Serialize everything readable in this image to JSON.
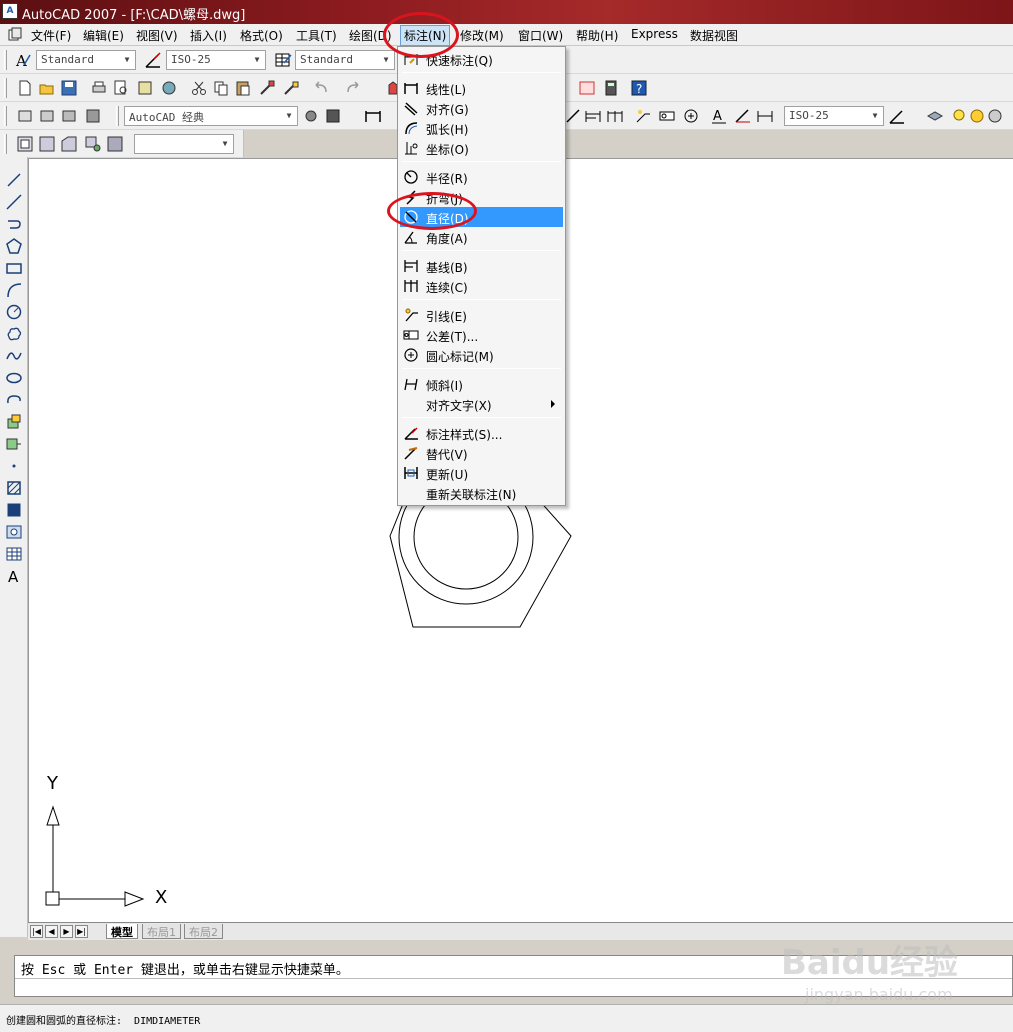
{
  "window": {
    "title": "AutoCAD 2007 - [F:\\CAD\\螺母.dwg]"
  },
  "menubar": {
    "items": [
      "文件(F)",
      "编辑(E)",
      "视图(V)",
      "插入(I)",
      "格式(O)",
      "工具(T)",
      "绘图(D)",
      "标注(N)",
      "修改(M)",
      "窗口(W)",
      "帮助(H)",
      "Express",
      "数据视图"
    ],
    "active": "标注(N)"
  },
  "toolbar_styles": {
    "text_style": "Standard",
    "dim_style": "ISO-25",
    "table_style": "Standard"
  },
  "toolbar_workspace": {
    "workspace": "AutoCAD 经典",
    "dim_style_right": "ISO-25"
  },
  "dropdown": {
    "items": [
      {
        "label": "快速标注(Q)",
        "icon": "quick-dimension-icon"
      },
      {
        "label": "线性(L)",
        "icon": "linear-dimension-icon"
      },
      {
        "label": "对齐(G)",
        "icon": "aligned-dimension-icon"
      },
      {
        "label": "弧长(H)",
        "icon": "arc-length-icon"
      },
      {
        "label": "坐标(O)",
        "icon": "ordinate-icon"
      },
      {
        "label": "半径(R)",
        "icon": "radius-icon"
      },
      {
        "label": "折弯(J)",
        "icon": "jogged-icon"
      },
      {
        "label": "直径(D)",
        "icon": "diameter-icon"
      },
      {
        "label": "角度(A)",
        "icon": "angular-icon"
      },
      {
        "label": "基线(B)",
        "icon": "baseline-icon"
      },
      {
        "label": "连续(C)",
        "icon": "continue-icon"
      },
      {
        "label": "引线(E)",
        "icon": "leader-icon"
      },
      {
        "label": "公差(T)...",
        "icon": "tolerance-icon"
      },
      {
        "label": "圆心标记(M)",
        "icon": "center-mark-icon"
      },
      {
        "label": "倾斜(I)",
        "icon": "oblique-icon"
      },
      {
        "label": "对齐文字(X)",
        "icon": ""
      },
      {
        "label": "标注样式(S)...",
        "icon": "dimension-style-icon"
      },
      {
        "label": "替代(V)",
        "icon": "override-icon"
      },
      {
        "label": "更新(U)",
        "icon": "update-icon"
      },
      {
        "label": "重新关联标注(N)",
        "icon": ""
      }
    ],
    "highlighted": "直径(D)"
  },
  "ucs": {
    "x_label": "X",
    "y_label": "Y"
  },
  "tabs": {
    "items": [
      "模型",
      "布局1",
      "布局2"
    ],
    "active": "模型"
  },
  "command": {
    "prompt": "按 Esc 或 Enter 键退出，或单击右键显示快捷菜单。"
  },
  "status": {
    "text": "创建圆和圆弧的直径标注:  DIMDIAMETER"
  },
  "watermark": {
    "brand": "Baidu经验",
    "url": "jingyan.baidu.com"
  },
  "colors": {
    "title_bar": "#8c1b1f",
    "highlight": "#3399ff",
    "annotation_circle": "#d9141e"
  }
}
